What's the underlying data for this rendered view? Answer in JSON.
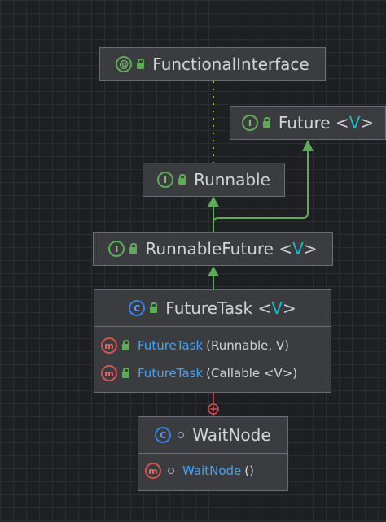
{
  "nodes": {
    "functional_interface": {
      "kind_icon": "annotation-icon",
      "kind_glyph": "@",
      "name": "FunctionalInterface",
      "generic": ""
    },
    "future": {
      "kind_icon": "interface-icon",
      "kind_glyph": "I",
      "name": "Future",
      "generic": "V"
    },
    "runnable": {
      "kind_icon": "interface-icon",
      "kind_glyph": "I",
      "name": "Runnable",
      "generic": ""
    },
    "runnable_future": {
      "kind_icon": "interface-icon",
      "kind_glyph": "I",
      "name": "RunnableFuture",
      "generic": "V"
    },
    "future_task": {
      "kind_icon": "class-icon",
      "kind_glyph": "C",
      "name": "FutureTask",
      "generic": "V",
      "methods": [
        {
          "icon": "method-icon",
          "glyph": "m",
          "name": "FutureTask",
          "params": "(Runnable, V)"
        },
        {
          "icon": "method-icon",
          "glyph": "m",
          "name": "FutureTask",
          "params": "(Callable <V>)"
        }
      ]
    },
    "wait_node": {
      "kind_icon": "inner-class-icon",
      "kind_glyph": "C",
      "name": "WaitNode",
      "generic": "",
      "methods": [
        {
          "icon": "method-icon",
          "glyph": "m",
          "name": "WaitNode",
          "params": "()"
        }
      ]
    }
  },
  "colors": {
    "background": "#1e1f22",
    "node_fill": "#3a3c40",
    "node_border": "#6b6f75",
    "inherit_arrow": "#5faa58",
    "annotation_link": "#b5b82a",
    "inner_link": "#d05454",
    "generic_param": "#20b8c9",
    "method_name": "#4aa0f0"
  }
}
